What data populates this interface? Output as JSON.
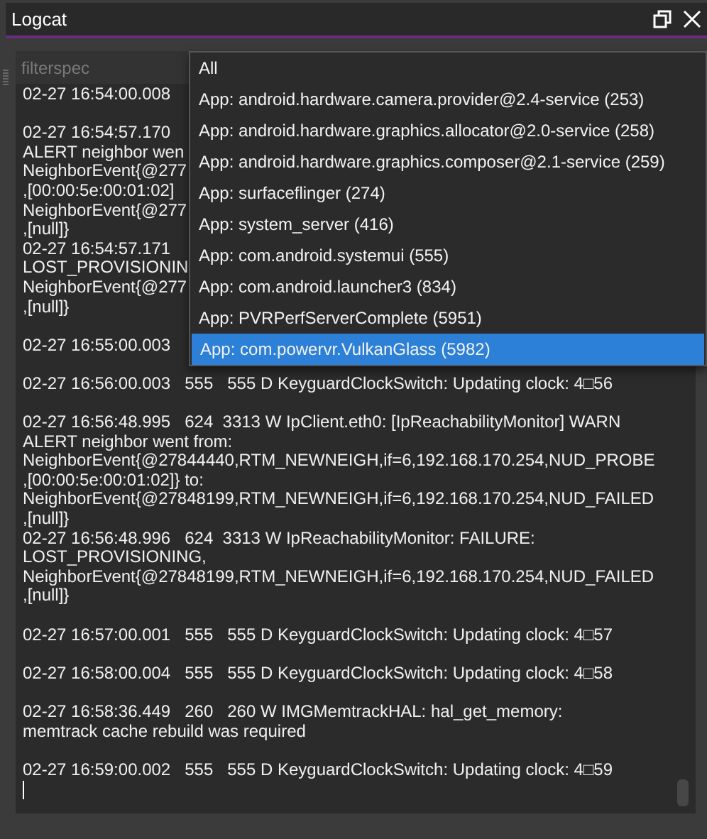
{
  "window": {
    "title": "Logcat"
  },
  "filter": {
    "placeholder": "filterspec"
  },
  "app_dropdown": {
    "options": [
      {
        "label": "All",
        "selected": false
      },
      {
        "label": "App: android.hardware.camera.provider@2.4-service (253)",
        "selected": false
      },
      {
        "label": "App: android.hardware.graphics.allocator@2.0-service (258)",
        "selected": false
      },
      {
        "label": "App: android.hardware.graphics.composer@2.1-service (259)",
        "selected": false
      },
      {
        "label": "App: surfaceflinger (274)",
        "selected": false
      },
      {
        "label": "App: system_server (416)",
        "selected": false
      },
      {
        "label": "App: com.android.systemui (555)",
        "selected": false
      },
      {
        "label": "App: com.android.launcher3 (834)",
        "selected": false
      },
      {
        "label": "App: PVRPerfServerComplete (5951)",
        "selected": false
      },
      {
        "label": "App: com.powervr.VulkanGlass (5982)",
        "selected": true
      }
    ]
  },
  "log": {
    "groups": [
      {
        "lines": [
          "02-27 16:54:00.008"
        ]
      },
      {
        "lines": [
          "02-27 16:54:57.170",
          "ALERT neighbor wen",
          "NeighborEvent{@277",
          ",[00:00:5e:00:01:02]",
          "NeighborEvent{@277",
          ",[null]}",
          "02-27 16:54:57.171",
          "LOST_PROVISIONIN",
          "NeighborEvent{@277",
          ",[null]}"
        ]
      },
      {
        "lines": [
          "02-27 16:55:00.003"
        ]
      },
      {
        "lines": [
          "02-27 16:56:00.003   555   555 D KeyguardClockSwitch: Updating clock: 4□56"
        ]
      },
      {
        "lines": [
          "02-27 16:56:48.995   624  3313 W IpClient.eth0: [IpReachabilityMonitor] WARN",
          "ALERT neighbor went from:",
          "NeighborEvent{@27844440,RTM_NEWNEIGH,if=6,192.168.170.254,NUD_PROBE",
          ",[00:00:5e:00:01:02]} to:",
          "NeighborEvent{@27848199,RTM_NEWNEIGH,if=6,192.168.170.254,NUD_FAILED",
          ",[null]}",
          "02-27 16:56:48.996   624  3313 W IpReachabilityMonitor: FAILURE:",
          "LOST_PROVISIONING,",
          "NeighborEvent{@27848199,RTM_NEWNEIGH,if=6,192.168.170.254,NUD_FAILED",
          ",[null]}"
        ]
      },
      {
        "lines": [
          "02-27 16:57:00.001   555   555 D KeyguardClockSwitch: Updating clock: 4□57"
        ]
      },
      {
        "lines": [
          "02-27 16:58:00.004   555   555 D KeyguardClockSwitch: Updating clock: 4□58"
        ]
      },
      {
        "lines": [
          "02-27 16:58:36.449   260   260 W IMGMemtrackHAL: hal_get_memory:",
          "memtrack cache rebuild was required"
        ]
      },
      {
        "lines": [
          "02-27 16:59:00.002   555   555 D KeyguardClockSwitch: Updating clock: 4□59"
        ]
      }
    ]
  }
}
